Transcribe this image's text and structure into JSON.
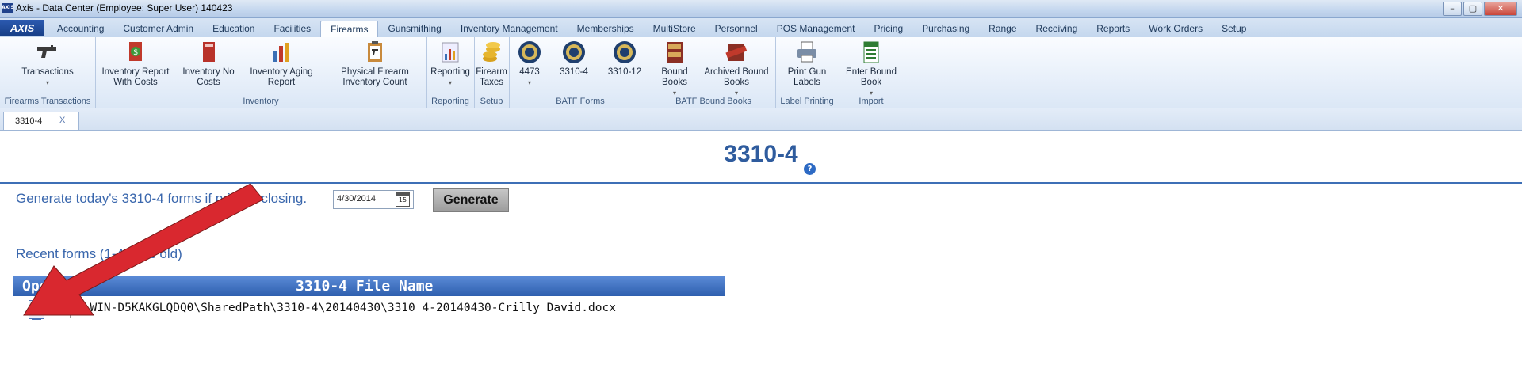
{
  "window": {
    "logo_text": "AXIS",
    "title": "Axis - Data Center  (Employee: Super User) 140423",
    "buttons": [
      "–",
      "▢",
      "✕"
    ]
  },
  "menu": {
    "brand": "AXIS",
    "tabs": [
      "Accounting",
      "Customer Admin",
      "Education",
      "Facilities",
      "Firearms",
      "Gunsmithing",
      "Inventory Management",
      "Memberships",
      "MultiStore",
      "Personnel",
      "POS Management",
      "Pricing",
      "Purchasing",
      "Range",
      "Receiving",
      "Reports",
      "Work Orders",
      "Setup"
    ],
    "active_tab": "Firearms"
  },
  "ribbon": {
    "groups": {
      "firearms_transactions": "Firearms Transactions",
      "inventory": "Inventory",
      "reporting": "Reporting",
      "setup": "Setup",
      "batf_forms": "BATF Forms",
      "batf_bound_books": "BATF Bound Books",
      "label_printing": "Label Printing",
      "import": "Import"
    },
    "buttons": {
      "transactions": "Transactions",
      "inv_report_costs": "Inventory Report With Costs",
      "inv_no_costs": "Inventory No Costs",
      "inv_aging": "Inventory Aging Report",
      "physical_count": "Physical Firearm Inventory Count",
      "reporting": "Reporting",
      "firearm_taxes": "Firearm Taxes",
      "f4473": "4473",
      "f3310_4": "3310-4",
      "f3310_12": "3310-12",
      "bound_books": "Bound Books",
      "archived_bound_books": "Archived Bound Books",
      "print_gun_labels": "Print Gun Labels",
      "enter_bound_book": "Enter Bound Book"
    },
    "dropdown_glyph": "▾",
    "icon_names": [
      "pistol-icon",
      "money-report-icon",
      "book-report-icon",
      "aging-chart-icon",
      "clipboard-icon",
      "chart-icon",
      "coins-icon",
      "seal-icon",
      "bound-book-icon",
      "archived-book-icon",
      "printer-icon",
      "excel-import-icon"
    ]
  },
  "doc_tab": {
    "label": "3310-4",
    "close": "X"
  },
  "page": {
    "title": "3310-4",
    "help": "?",
    "generate_text": "Generate today's 3310-4 forms if prior to closing.",
    "date_value": "4/30/2014",
    "cal_day": "15",
    "generate_label": "Generate",
    "recent_text": "Recent forms (1-4 days old)",
    "grid": {
      "headers": [
        "Open",
        "3310-4 File Name"
      ],
      "rows": [
        {
          "file": "\\\\WIN-D5KAKGLQDQ0\\SharedPath\\3310-4\\20140430\\3310_4-20140430-Crilly_David.docx"
        }
      ]
    }
  },
  "colors": {
    "accent": "#2f5c9e",
    "header_blue": "#3d6fb6",
    "annotation_arrow": "#d9282f"
  }
}
